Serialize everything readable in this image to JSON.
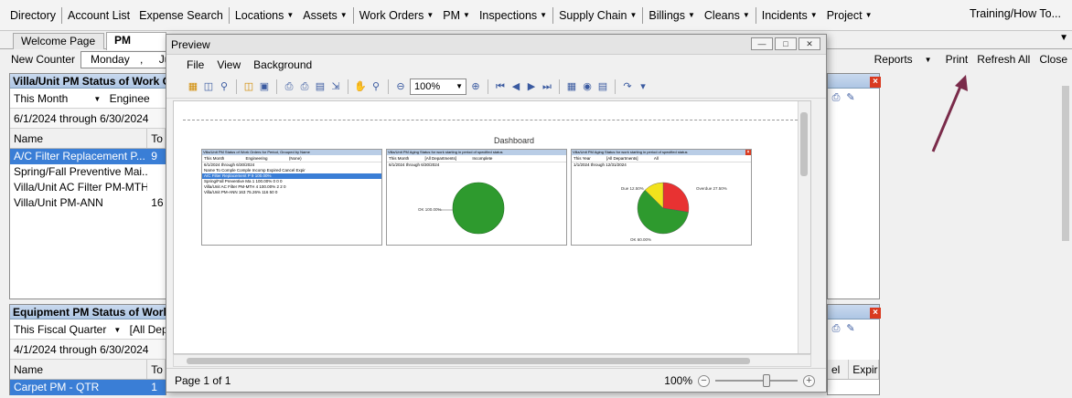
{
  "menu": {
    "items": [
      {
        "label": "Directory",
        "dropdown": false
      },
      {
        "label": "Account List",
        "dropdown": false
      },
      {
        "label": "Expense Search",
        "dropdown": false
      },
      {
        "label": "Locations",
        "dropdown": true
      },
      {
        "label": "Assets",
        "dropdown": true
      },
      {
        "label": "Work Orders",
        "dropdown": true
      },
      {
        "label": "PM",
        "dropdown": true
      },
      {
        "label": "Inspections",
        "dropdown": true
      },
      {
        "label": "Supply Chain",
        "dropdown": true
      },
      {
        "label": "Billings",
        "dropdown": true
      },
      {
        "label": "Cleans",
        "dropdown": true
      },
      {
        "label": "Incidents",
        "dropdown": true
      },
      {
        "label": "Project",
        "dropdown": true
      }
    ],
    "right": "Training/How To..."
  },
  "tabs": {
    "welcome": "Welcome Page",
    "pm_dashboard": "PM Dashb"
  },
  "dashbar": {
    "new_counter": "New Counter",
    "date_day": "Monday",
    "date_sep": ",",
    "date_month": "Ju",
    "reports": "Reports",
    "print": "Print",
    "refresh_all": "Refresh All",
    "close": "Close"
  },
  "panel_villa": {
    "title": "Villa/Unit PM Status of Work Ord",
    "period": "This Month",
    "department": "Enginee",
    "range": "6/1/2024 through 6/30/2024",
    "col_name": "Name",
    "col_total": "To",
    "rows": [
      {
        "name": "A/C Filter Replacement P...",
        "total": "9",
        "selected": true
      },
      {
        "name": "Spring/Fall Preventive Mai...",
        "total": "",
        "selected": false
      },
      {
        "name": "Villa/Unit AC Filter PM-MTH",
        "total": "",
        "selected": false
      },
      {
        "name": "Villa/Unit PM-ANN",
        "total": "16",
        "selected": false
      }
    ]
  },
  "panel_equipment": {
    "title": "Equipment PM Status of Work Or",
    "period": "This Fiscal Quarter",
    "department": "[All Dep",
    "range": "4/1/2024 through 6/30/2024",
    "col_name": "Name",
    "col_total": "To",
    "col_cancel": "el",
    "col_expir": "Expir",
    "rows": [
      {
        "name": "Carpet PM - QTR",
        "total": "1",
        "selected": true
      }
    ]
  },
  "preview": {
    "title": "Preview",
    "menu": [
      "File",
      "View",
      "Background"
    ],
    "zoom_value": "100%",
    "page_status": "Page 1 of 1",
    "zoom_status": "100%",
    "dashboard_title": "Dashboard",
    "mini1": {
      "title": "Villa/Unit PM Status of Work Orders for Period, Grouped by Name",
      "filter_period": "This Month",
      "filter_dept": "Engineering",
      "filter_other": "(None)",
      "range": "6/1/2024 through 6/30/2024",
      "rows": [
        "Name  To  Comple  Comple  Incomp  Expired  Cancel  Expir",
        "A/C Filter Replacement P   9  100.00%",
        "Spring/Fall Preventive Ma   1  100.00%   0   0   0",
        "Villa/Unit AC Filter PM-MTH   4  100.00%   2   2   0",
        "Villa/Unit PM-ANN   163  75.26%   116   50   0"
      ]
    },
    "mini2": {
      "title": "Villa/Unit PM Aging Status for work starting in period of specified status",
      "filter_period": "This Month",
      "filter_dept": "[All Departments]",
      "filter_status": "Incomplete",
      "range": "6/1/2024 through 6/30/2024",
      "pie_label": "OK 100.00%"
    },
    "mini3": {
      "title": "Villa/Unit PM Aging Status for work starting in period of specified status",
      "filter_period": "This Year",
      "filter_dept": "[All Departments]",
      "filter_status": "All",
      "range": "1/1/2024 through 12/31/2024",
      "label_due": "Due 12.50%",
      "label_overdue": "Overdue 27.50%",
      "label_ok": "OK 60.00%"
    }
  },
  "colors": {
    "accent_blue": "#3a7ed6",
    "pie_green": "#2e9a2e",
    "pie_red": "#e83232",
    "pie_yellow": "#f2e21c",
    "arrow": "#7a2b4a"
  },
  "pie_ok": {
    "ok": 1.0
  },
  "pie_aging": {
    "ok": 0.6,
    "overdue": 0.275,
    "due": 0.125
  }
}
